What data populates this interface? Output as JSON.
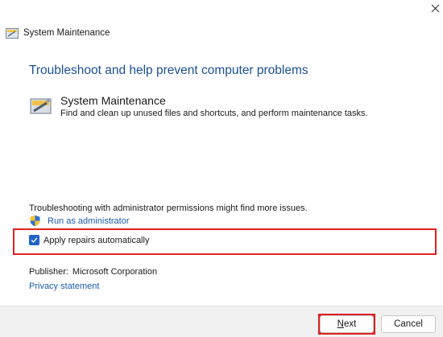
{
  "window": {
    "title": "System Maintenance",
    "close_label": "✕"
  },
  "main": {
    "heading": "Troubleshoot and help prevent computer problems",
    "task": {
      "name": "System Maintenance",
      "description": "Find and clean up unused files and shortcuts, and perform maintenance tasks."
    },
    "admin_notice": "Troubleshooting with administrator permissions might find more issues.",
    "run_as_admin": "Run as administrator",
    "apply_repairs": {
      "label": "Apply repairs automatically",
      "checked": true
    },
    "publisher_label": "Publisher:",
    "publisher_value": "Microsoft Corporation",
    "privacy_link": "Privacy statement"
  },
  "footer": {
    "next_accel": "N",
    "next_rest": "ext",
    "cancel": "Cancel"
  },
  "colors": {
    "heading": "#1c4f96",
    "link": "#1c5bb0",
    "checkbox": "#1e63c8",
    "highlight": "#e02020"
  }
}
